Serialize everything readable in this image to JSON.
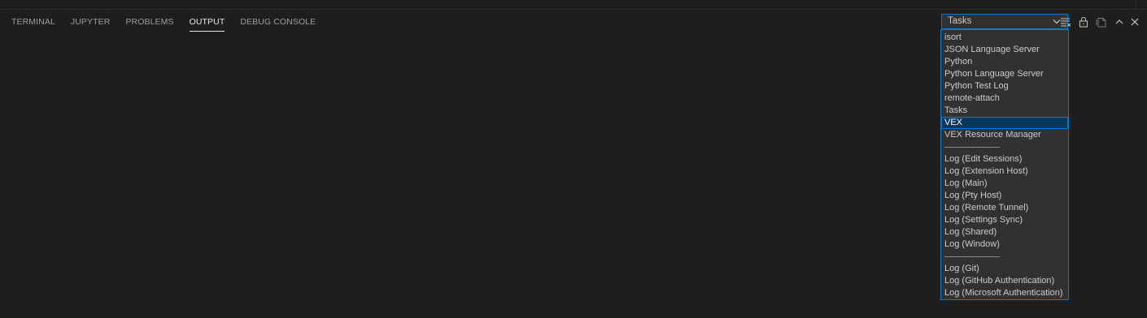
{
  "tabs": [
    {
      "label": "TERMINAL"
    },
    {
      "label": "JUPYTER"
    },
    {
      "label": "PROBLEMS"
    },
    {
      "label": "OUTPUT"
    },
    {
      "label": "DEBUG CONSOLE"
    }
  ],
  "active_tab": "OUTPUT",
  "output_select": {
    "value": "Tasks",
    "options": [
      "isort",
      "JSON Language Server",
      "Python",
      "Python Language Server",
      "Python Test Log",
      "remote-attach",
      "Tasks",
      "VEX",
      "VEX Resource Manager",
      "----",
      "Log (Edit Sessions)",
      "Log (Extension Host)",
      "Log (Main)",
      "Log (Pty Host)",
      "Log (Remote Tunnel)",
      "Log (Settings Sync)",
      "Log (Shared)",
      "Log (Window)",
      "----",
      "Log (Git)",
      "Log (GitHub Authentication)",
      "Log (Microsoft Authentication)"
    ],
    "highlighted": "VEX"
  },
  "toolbar_icons": [
    "clear-output-icon",
    "lock-icon",
    "open-in-editor-icon",
    "maximize-panel-icon",
    "close-icon"
  ],
  "colors": {
    "background": "#1e1e1e",
    "dropdown_bg": "#313131",
    "focus_border": "#0078d4",
    "selected_bg": "#04395e"
  }
}
